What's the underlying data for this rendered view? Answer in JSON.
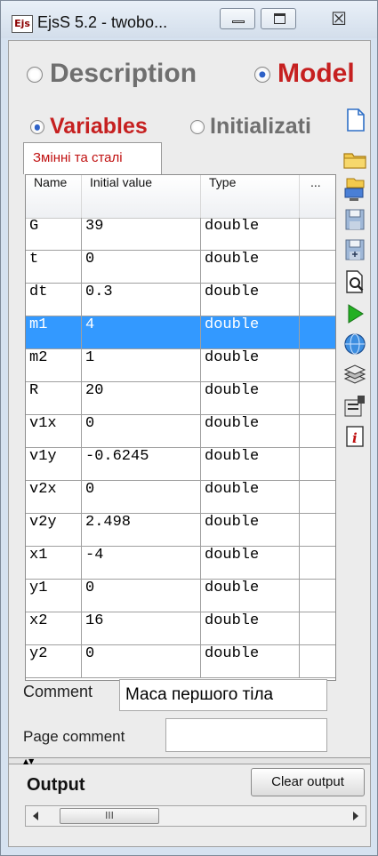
{
  "window": {
    "logo_text": "Ejs",
    "title": "EjsS 5.2 - twobo...",
    "close_glyph": "☒"
  },
  "top_tabs": [
    {
      "label": "Description",
      "selected": false,
      "color": "#6f6f6f"
    },
    {
      "label": "Model",
      "selected": true,
      "color": "#c62020"
    }
  ],
  "sub_tabs": [
    {
      "label": "Variables",
      "selected": true,
      "color": "#c62020"
    },
    {
      "label": "Initializati",
      "selected": false,
      "color": "#6f6f6f"
    }
  ],
  "page_tab": {
    "label": "Змінні та сталі"
  },
  "table": {
    "columns": [
      "Name",
      "Initial value",
      "Type",
      "..."
    ],
    "rows": [
      {
        "name": "G",
        "value": "39",
        "type": "double",
        "selected": false
      },
      {
        "name": "t",
        "value": "0",
        "type": "double",
        "selected": false
      },
      {
        "name": "dt",
        "value": "0.3",
        "type": "double",
        "selected": false
      },
      {
        "name": "m1",
        "value": "4",
        "type": "double",
        "selected": true
      },
      {
        "name": "m2",
        "value": "1",
        "type": "double",
        "selected": false
      },
      {
        "name": "R",
        "value": "20",
        "type": "double",
        "selected": false
      },
      {
        "name": "v1x",
        "value": "0",
        "type": "double",
        "selected": false
      },
      {
        "name": "v1y",
        "value": "-0.6245",
        "type": "double",
        "selected": false
      },
      {
        "name": "v2x",
        "value": "0",
        "type": "double",
        "selected": false
      },
      {
        "name": "v2y",
        "value": "2.498",
        "type": "double",
        "selected": false
      },
      {
        "name": "x1",
        "value": "-4",
        "type": "double",
        "selected": false
      },
      {
        "name": "y1",
        "value": "0",
        "type": "double",
        "selected": false
      },
      {
        "name": "x2",
        "value": "16",
        "type": "double",
        "selected": false
      },
      {
        "name": "y2",
        "value": "0",
        "type": "double",
        "selected": false
      }
    ]
  },
  "toolbar_icons": [
    "new-file-icon",
    "open-folder-icon",
    "open-network-icon",
    "save-icon",
    "save-as-icon",
    "search-document-icon",
    "run-icon",
    "web-globe-icon",
    "library-icon",
    "preferences-icon",
    "info-icon"
  ],
  "comment": {
    "label": "Comment",
    "value": "Маса першого тіла"
  },
  "page_comment": {
    "label": "Page comment",
    "value": ""
  },
  "splitter": {
    "glyphs": "▲▼"
  },
  "output": {
    "title": "Output",
    "clear_label": "Clear output",
    "scroll_grip": "III"
  },
  "colors": {
    "selection": "#3399ff",
    "accent_red": "#c62020",
    "window_frame": "#d6e2f0"
  }
}
